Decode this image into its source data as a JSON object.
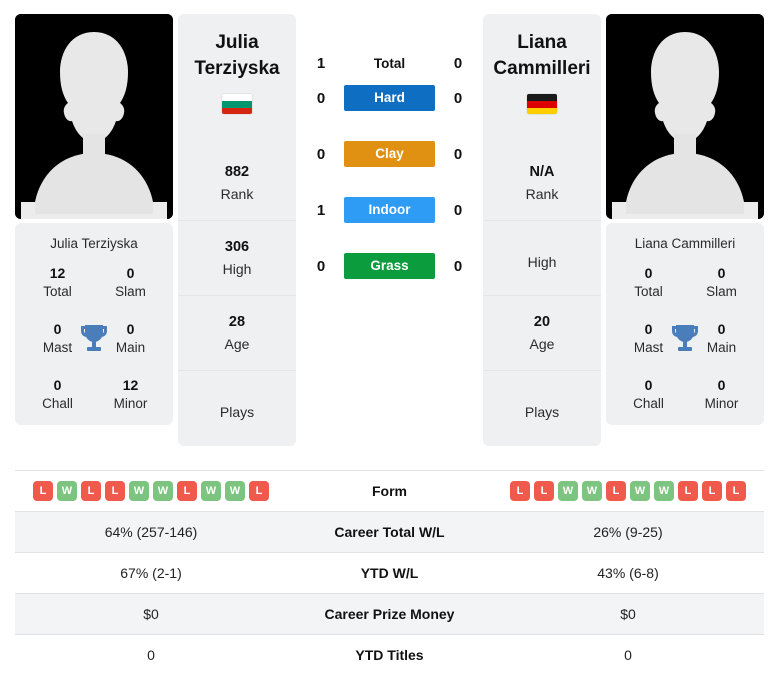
{
  "colors": {
    "hard": "#0d6ec2",
    "clay": "#e09112",
    "indoor": "#2e9bf5",
    "grass": "#0a9c3d",
    "win": "#7cc47f",
    "loss": "#ef5a4c",
    "card_bg": "#eff0f1",
    "trophy": "#4a7ebb"
  },
  "left_player": {
    "name_line1": "Julia",
    "name_line2": "Terziyska",
    "full_name": "Julia Terziyska",
    "flag_name": "bulgaria-flag",
    "flag_bands": [
      "#ffffff",
      "#00966e",
      "#d62612"
    ],
    "info": [
      {
        "value": "882",
        "label": "Rank"
      },
      {
        "value": "306",
        "label": "High"
      },
      {
        "value": "28",
        "label": "Age"
      },
      {
        "value": "",
        "label": "Plays"
      }
    ],
    "titles": [
      {
        "value": "12",
        "label": "Total"
      },
      {
        "value": "0",
        "label": "Slam"
      },
      {
        "value": "0",
        "label": "Mast"
      },
      {
        "value": "0",
        "label": "Main"
      },
      {
        "value": "0",
        "label": "Chall"
      },
      {
        "value": "12",
        "label": "Minor"
      }
    ],
    "form": [
      "L",
      "W",
      "L",
      "L",
      "W",
      "W",
      "L",
      "W",
      "W",
      "L"
    ],
    "stats": {
      "career_total_wl": "64% (257-146)",
      "ytd_wl": "67% (2-1)",
      "career_prize_money": "$0",
      "ytd_titles": "0"
    }
  },
  "right_player": {
    "name_line1": "Liana",
    "name_line2": "Cammilleri",
    "full_name": "Liana Cammilleri",
    "flag_name": "germany-flag",
    "flag_bands": [
      "#1a1a1a",
      "#dd0000",
      "#ffce00"
    ],
    "info": [
      {
        "value": "N/A",
        "label": "Rank"
      },
      {
        "value": "",
        "label": "High"
      },
      {
        "value": "20",
        "label": "Age"
      },
      {
        "value": "",
        "label": "Plays"
      }
    ],
    "titles": [
      {
        "value": "0",
        "label": "Total"
      },
      {
        "value": "0",
        "label": "Slam"
      },
      {
        "value": "0",
        "label": "Mast"
      },
      {
        "value": "0",
        "label": "Main"
      },
      {
        "value": "0",
        "label": "Chall"
      },
      {
        "value": "0",
        "label": "Minor"
      }
    ],
    "form": [
      "L",
      "L",
      "W",
      "W",
      "L",
      "W",
      "W",
      "L",
      "L",
      "L"
    ],
    "stats": {
      "career_total_wl": "26% (9-25)",
      "ytd_wl": "43% (6-8)",
      "career_prize_money": "$0",
      "ytd_titles": "0"
    }
  },
  "head_to_head": {
    "total": {
      "label": "Total",
      "left": "1",
      "right": "0"
    },
    "surfaces": [
      {
        "label": "Hard",
        "left": "0",
        "right": "0",
        "color": "#0d6ec2"
      },
      {
        "label": "Clay",
        "left": "0",
        "right": "0",
        "color": "#e09112"
      },
      {
        "label": "Indoor",
        "left": "1",
        "right": "0",
        "color": "#2e9bf5"
      },
      {
        "label": "Grass",
        "left": "0",
        "right": "0",
        "color": "#0a9c3d"
      }
    ]
  },
  "stats_table": {
    "rows": [
      {
        "key": "form",
        "label": "Form",
        "type": "form"
      },
      {
        "key": "career_total_wl",
        "label": "Career Total W/L",
        "type": "text"
      },
      {
        "key": "ytd_wl",
        "label": "YTD W/L",
        "type": "text"
      },
      {
        "key": "career_prize_money",
        "label": "Career Prize Money",
        "type": "text"
      },
      {
        "key": "ytd_titles",
        "label": "YTD Titles",
        "type": "text"
      }
    ]
  }
}
